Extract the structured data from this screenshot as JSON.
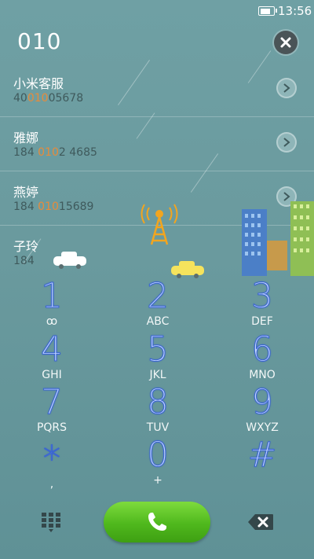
{
  "status_bar": {
    "time": "13:56"
  },
  "dial_input": {
    "number": "010"
  },
  "contacts": [
    {
      "name": "小米客服",
      "number_pre": "40",
      "number_hl": "010",
      "number_post": "05678"
    },
    {
      "name": "雅娜",
      "number_pre": "184 ",
      "number_hl": "010",
      "number_post": "2 4685"
    },
    {
      "name": "燕婷",
      "number_pre": "184 ",
      "number_hl": "010",
      "number_post": "15689"
    },
    {
      "name": "子玲",
      "number_pre": "184",
      "number_hl": "",
      "number_post": ""
    }
  ],
  "keypad": [
    {
      "digit": "1",
      "letters": "ꝏ"
    },
    {
      "digit": "2",
      "letters": "ABC"
    },
    {
      "digit": "3",
      "letters": "DEF"
    },
    {
      "digit": "4",
      "letters": "GHI"
    },
    {
      "digit": "5",
      "letters": "JKL"
    },
    {
      "digit": "6",
      "letters": "MNO"
    },
    {
      "digit": "7",
      "letters": "PQRS"
    },
    {
      "digit": "8",
      "letters": "TUV"
    },
    {
      "digit": "9",
      "letters": "WXYZ"
    },
    {
      "digit": "*",
      "letters": ","
    },
    {
      "digit": "0",
      "letters": "+"
    },
    {
      "digit": "#",
      "letters": ""
    }
  ],
  "colors": {
    "accent_green": "#4fb81d",
    "highlight": "#e88b3a",
    "background": "#6b9ca0"
  },
  "icons": {
    "clear": "close-icon",
    "contact_arrow": "chevron-right-icon",
    "tower": "signal-tower-icon",
    "dialpad_toggle": "dialpad-grid-icon",
    "call": "phone-icon",
    "backspace": "backspace-icon"
  }
}
